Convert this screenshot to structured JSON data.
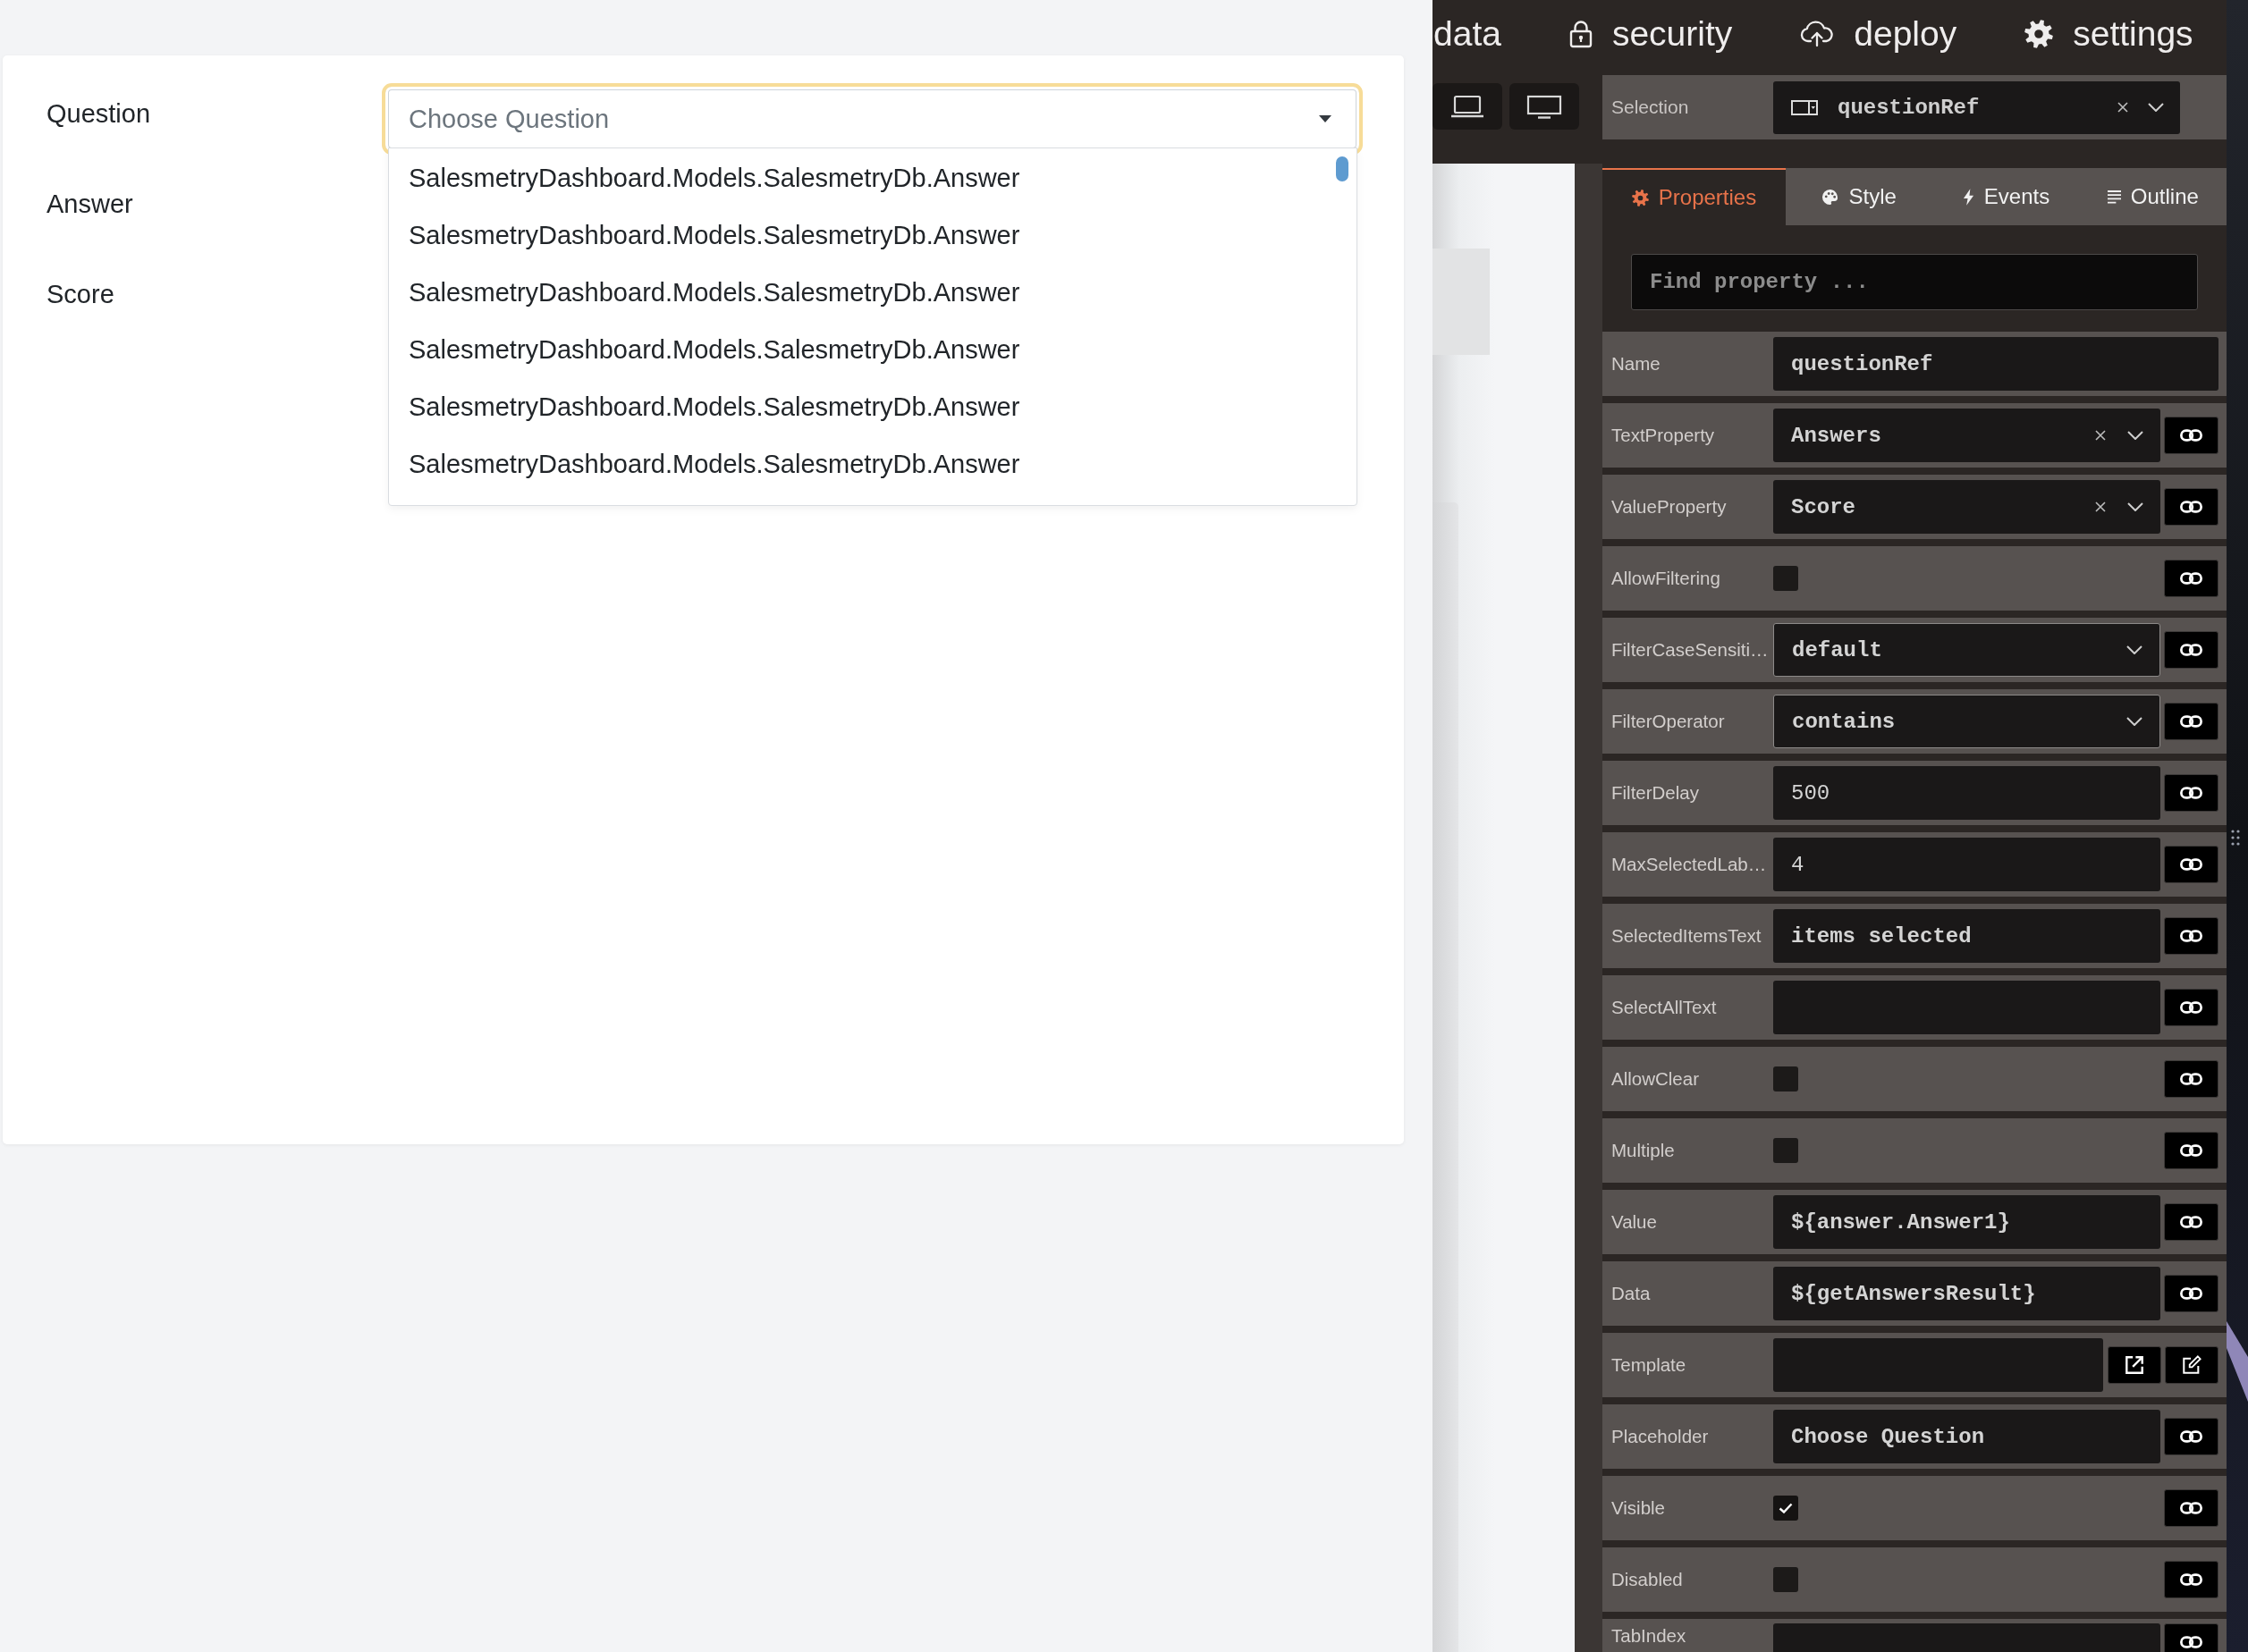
{
  "form": {
    "fields": [
      {
        "label": "Question",
        "kind": "dropdown",
        "placeholder": "Choose Question",
        "focused": true,
        "expanded": true,
        "options": [
          "SalesmetryDashboard.Models.SalesmetryDb.Answer",
          "SalesmetryDashboard.Models.SalesmetryDb.Answer",
          "SalesmetryDashboard.Models.SalesmetryDb.Answer",
          "SalesmetryDashboard.Models.SalesmetryDb.Answer",
          "SalesmetryDashboard.Models.SalesmetryDb.Answer",
          "SalesmetryDashboard.Models.SalesmetryDb.Answer"
        ]
      },
      {
        "label": "Answer"
      },
      {
        "label": "Score"
      }
    ]
  },
  "top_nav": {
    "items": [
      {
        "label": "data"
      },
      {
        "label": "security"
      },
      {
        "label": "deploy"
      },
      {
        "label": "settings"
      }
    ]
  },
  "selection": {
    "label": "Selection",
    "value": "questionRef"
  },
  "tabs": [
    {
      "label": "Properties",
      "selected": true
    },
    {
      "label": "Style",
      "selected": false
    },
    {
      "label": "Events",
      "selected": false
    },
    {
      "label": "Outline",
      "selected": false
    }
  ],
  "search": {
    "placeholder": "Find property ..."
  },
  "properties": [
    {
      "label": "Name",
      "kind": "text",
      "value": "questionRef",
      "bindable": false
    },
    {
      "label": "TextProperty",
      "kind": "select",
      "value": "Answers",
      "clearable": true,
      "bindable": true
    },
    {
      "label": "ValueProperty",
      "kind": "select",
      "value": "Score",
      "clearable": true,
      "bindable": true
    },
    {
      "label": "AllowFiltering",
      "kind": "checkbox",
      "checked": false,
      "bindable": true
    },
    {
      "label": "FilterCaseSensiti…",
      "kind": "select",
      "value": "default",
      "clearable": false,
      "bindable": true
    },
    {
      "label": "FilterOperator",
      "kind": "select",
      "value": "contains",
      "clearable": false,
      "bindable": true
    },
    {
      "label": "FilterDelay",
      "kind": "number",
      "value": "500",
      "bindable": true
    },
    {
      "label": "MaxSelectedLab…",
      "kind": "number",
      "value": "4",
      "bindable": true
    },
    {
      "label": "SelectedItemsText",
      "kind": "text",
      "value": "items selected",
      "bindable": true
    },
    {
      "label": "SelectAllText",
      "kind": "text",
      "bindable": true
    },
    {
      "label": "AllowClear",
      "kind": "checkbox",
      "checked": false,
      "bindable": true
    },
    {
      "label": "Multiple",
      "kind": "checkbox",
      "checked": false,
      "bindable": true
    },
    {
      "label": "Value",
      "kind": "text",
      "value": "${answer.Answer1}",
      "bindable": true
    },
    {
      "label": "Data",
      "kind": "text",
      "value": "${getAnswersResult}",
      "bindable": true
    },
    {
      "label": "Template",
      "kind": "template",
      "bindable": false
    },
    {
      "label": "Placeholder",
      "kind": "text",
      "value": "Choose Question",
      "bindable": true
    },
    {
      "label": "Visible",
      "kind": "checkbox",
      "checked": true,
      "bindable": true
    },
    {
      "label": "Disabled",
      "kind": "checkbox",
      "checked": false,
      "bindable": true
    },
    {
      "label": "TabIndex",
      "kind": "number",
      "bindable": true
    }
  ]
}
